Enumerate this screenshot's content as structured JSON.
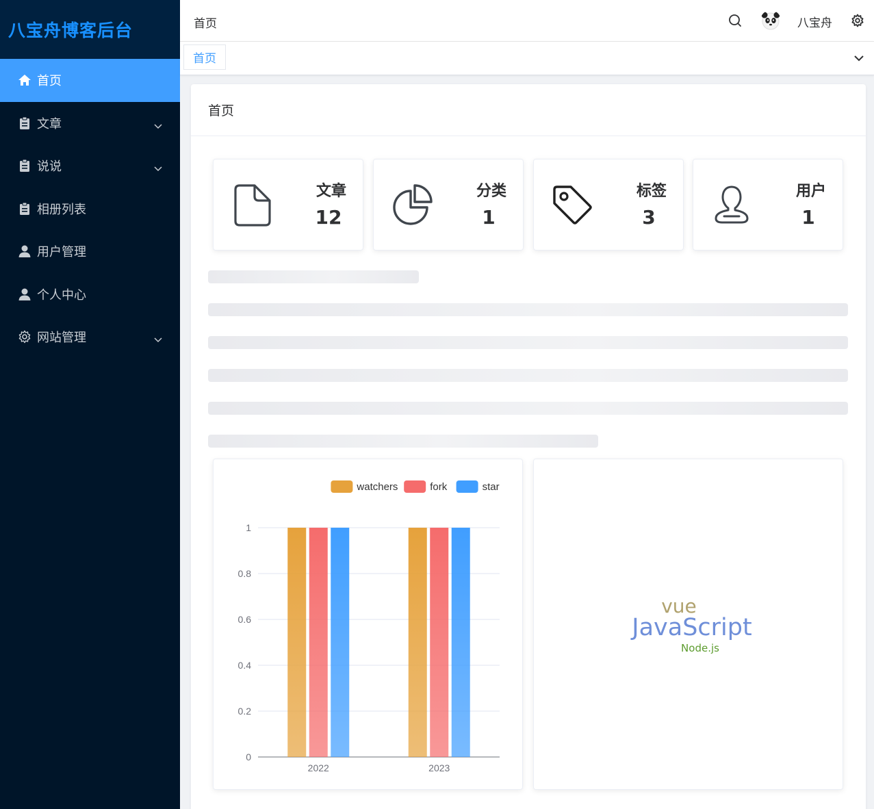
{
  "app": {
    "title": "八宝舟博客后台"
  },
  "sidebar": {
    "items": [
      {
        "label": "首页",
        "icon": "home-icon",
        "active": true
      },
      {
        "label": "文章",
        "icon": "clipboard-icon",
        "expandable": true
      },
      {
        "label": "说说",
        "icon": "clipboard-icon",
        "expandable": true
      },
      {
        "label": "相册列表",
        "icon": "clipboard-icon"
      },
      {
        "label": "用户管理",
        "icon": "user-icon"
      },
      {
        "label": "个人中心",
        "icon": "user-icon"
      },
      {
        "label": "网站管理",
        "icon": "gear-icon",
        "expandable": true
      }
    ]
  },
  "header": {
    "breadcrumb": "首页",
    "username": "八宝舟"
  },
  "tags": {
    "active": "首页"
  },
  "main": {
    "card_title": "首页",
    "stats": [
      {
        "title": "文章",
        "value": "12",
        "icon": "document-icon"
      },
      {
        "title": "分类",
        "value": "1",
        "icon": "pie-chart-icon"
      },
      {
        "title": "标签",
        "value": "3",
        "icon": "price-tag-icon"
      },
      {
        "title": "用户",
        "value": "1",
        "icon": "user-outline-icon"
      }
    ],
    "tech_words": {
      "vue": "vue",
      "javascript": "JavaScript",
      "nodejs": "Node.js"
    }
  },
  "colors": {
    "accent": "#409eff",
    "sidebar_bg": "#001529",
    "logo": "#1890ff",
    "vue": "#b0a26e",
    "javascript": "#6f8fd9",
    "nodejs": "#5d9c2f"
  },
  "chart_data": {
    "type": "bar",
    "categories": [
      "2022",
      "2023"
    ],
    "series": [
      {
        "name": "watchers",
        "values": [
          1,
          1
        ],
        "color": "#e6a23c"
      },
      {
        "name": "fork",
        "values": [
          1,
          1
        ],
        "color": "#f56c6c"
      },
      {
        "name": "star",
        "values": [
          1,
          1
        ],
        "color": "#409eff"
      }
    ],
    "ylim": [
      0,
      1
    ],
    "yticks": [
      "0",
      "0.2",
      "0.4",
      "0.6",
      "0.8",
      "1"
    ],
    "grid": true,
    "legend": "top-right"
  }
}
